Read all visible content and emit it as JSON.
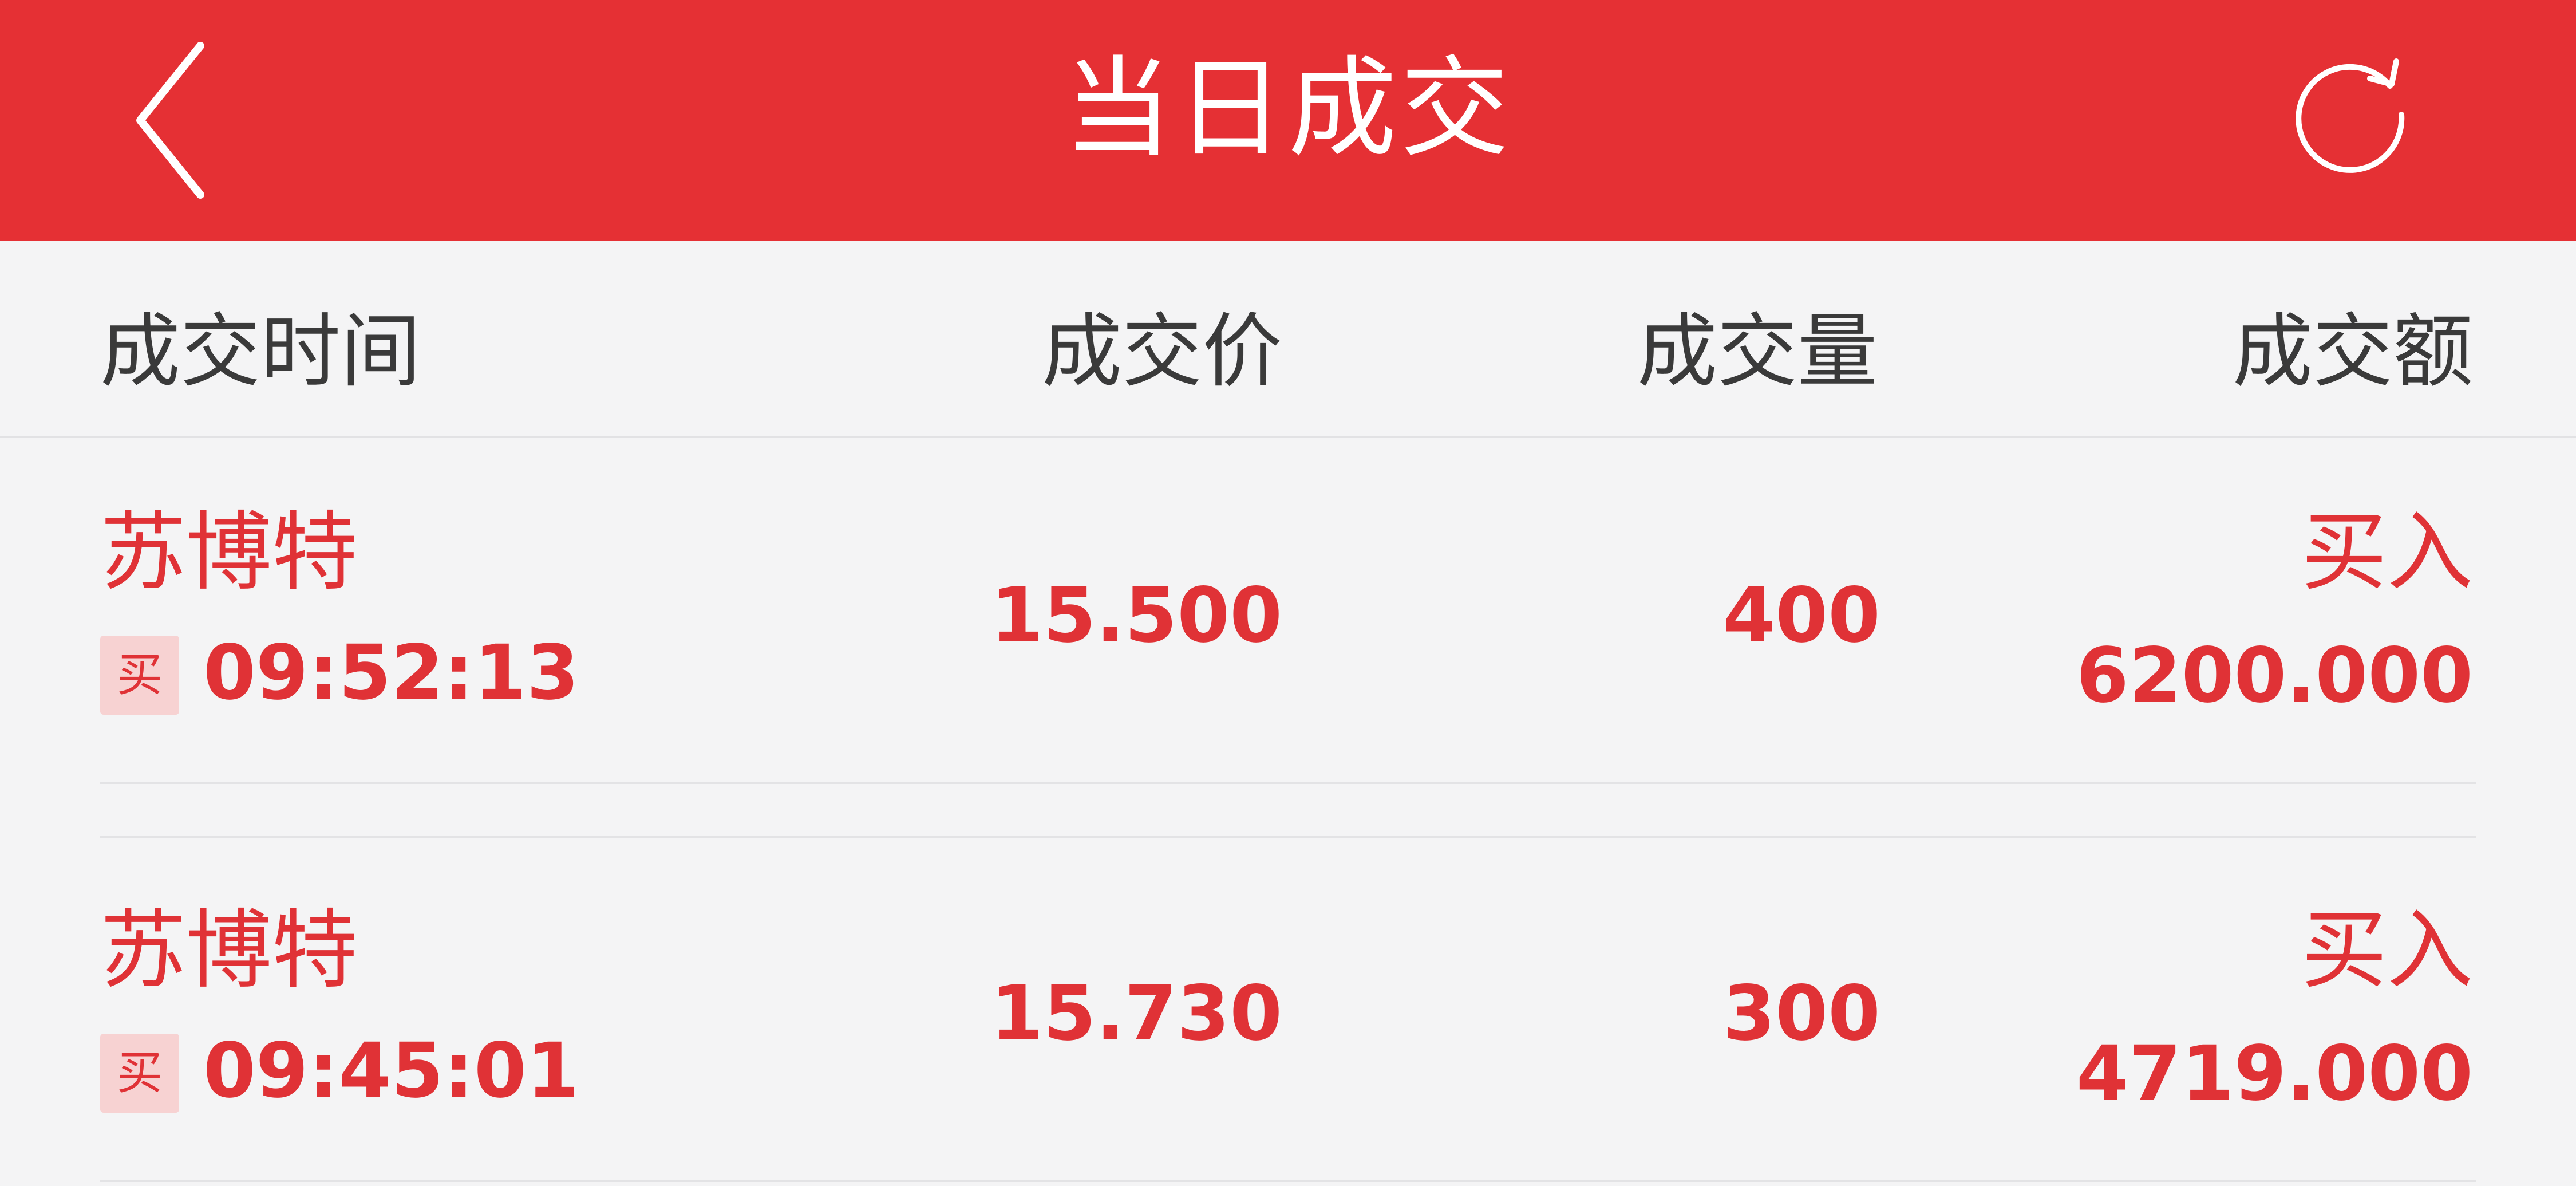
{
  "header": {
    "title": "当日成交",
    "back_icon": "chevron-left-icon",
    "refresh_icon": "refresh-icon"
  },
  "columns": {
    "time": "成交时间",
    "price": "成交价",
    "volume": "成交量",
    "amount": "成交额"
  },
  "trades": [
    {
      "name": "苏博特",
      "side_badge": "买",
      "time": "09:52:13",
      "price": "15.500",
      "volume": "400",
      "side": "买入",
      "amount": "6200.000"
    },
    {
      "name": "苏博特",
      "side_badge": "买",
      "time": "09:45:01",
      "price": "15.730",
      "volume": "300",
      "side": "买入",
      "amount": "4719.000"
    }
  ],
  "colors": {
    "header_bg": "#e53034",
    "accent_red": "#e03236",
    "page_bg": "#f4f4f5",
    "badge_bg": "#f7d2d2"
  }
}
